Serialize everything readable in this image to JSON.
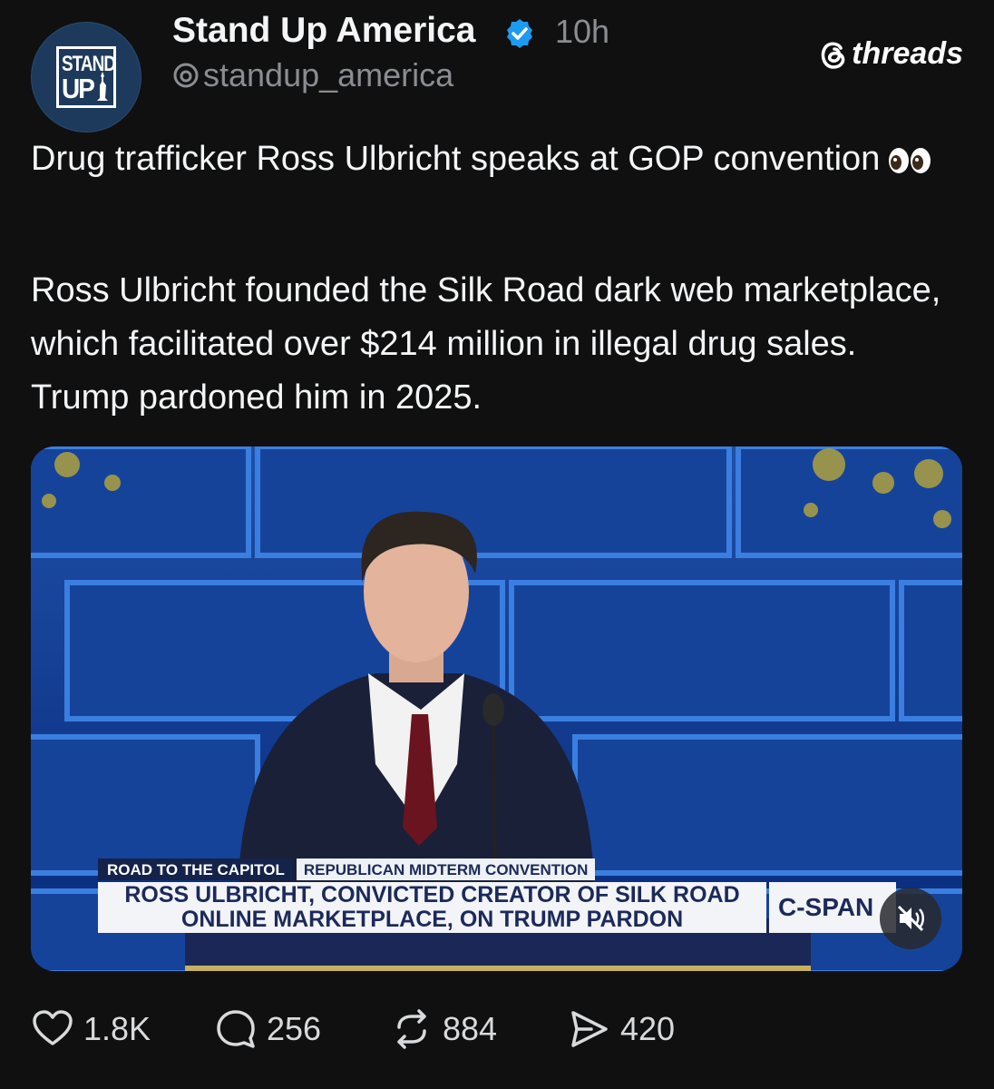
{
  "header": {
    "avatar": {
      "line1": "STAND",
      "line2": "UP",
      "icon": "stand-up-america-logo"
    },
    "username": "Stand Up America",
    "verified_icon": "verified-badge-icon",
    "time_ago": "10h",
    "handle": "standup_america",
    "brand": "threads"
  },
  "post": {
    "paragraph1": "Drug trafficker Ross Ulbricht speaks at GOP convention",
    "emoji": "eyes-emoji",
    "paragraph2": "Ross Ulbricht founded the Silk Road dark web marketplace, which facilitated over $214 million in illegal drug sales. Trump pardoned him in 2025."
  },
  "media": {
    "chyron_tag": "ROAD TO THE CAPITOL",
    "chyron_event": "REPUBLICAN MIDTERM CONVENTION",
    "chyron_line1": "ROSS ULBRICHT, CONVICTED CREATOR OF SILK ROAD",
    "chyron_line2": "ONLINE MARKETPLACE, ON TRUMP PARDON",
    "network": "C-SPAN",
    "mute_icon": "speaker-muted-icon"
  },
  "actions": {
    "likes": "1.8K",
    "replies": "256",
    "reposts": "884",
    "shares": "420"
  }
}
